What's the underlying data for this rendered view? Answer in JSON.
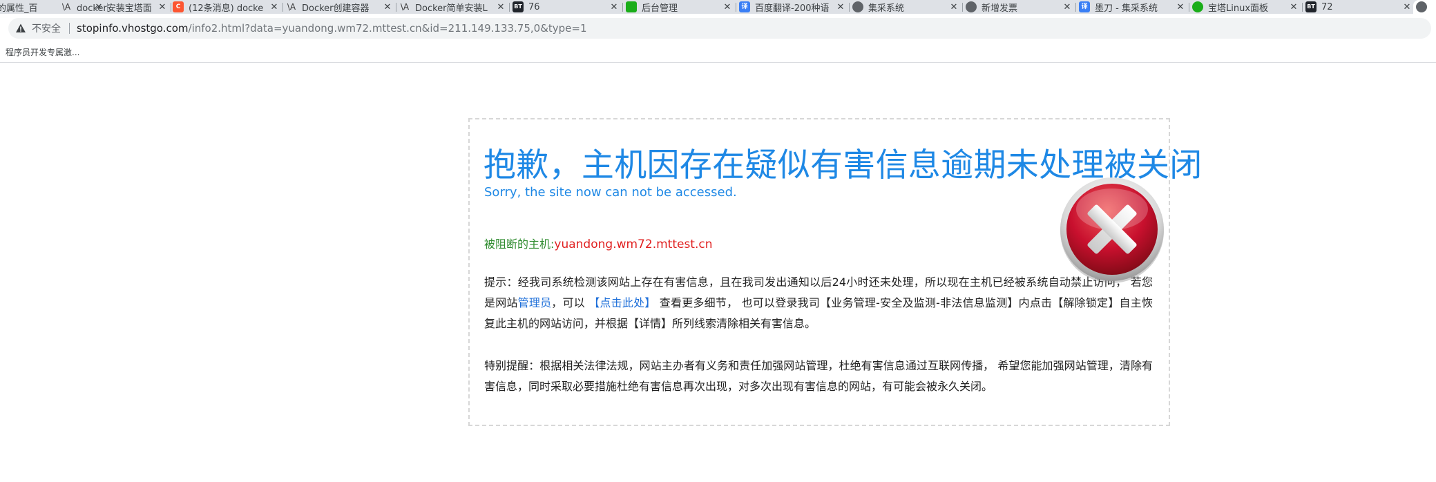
{
  "browser": {
    "tabs": [
      {
        "title": "的属性_百",
        "favicon": "none",
        "close": "✕"
      },
      {
        "title": "docker安装宝塔面",
        "favicon": "va",
        "close": "✕"
      },
      {
        "title": "(12条消息) docke",
        "favicon": "c",
        "close": "✕"
      },
      {
        "title": "Docker创建容器",
        "favicon": "va",
        "close": "✕"
      },
      {
        "title": "Docker简单安装L",
        "favicon": "va",
        "close": "✕"
      },
      {
        "title": "76",
        "favicon": "bt",
        "close": "✕"
      },
      {
        "title": "后台管理",
        "favicon": "green",
        "close": "✕"
      },
      {
        "title": "百度翻译-200种语",
        "favicon": "blue",
        "close": "✕"
      },
      {
        "title": "集采系统",
        "favicon": "globe",
        "close": "✕"
      },
      {
        "title": "新增发票",
        "favicon": "globe",
        "close": "✕"
      },
      {
        "title": "墨刀 - 集采系统",
        "favicon": "blue",
        "close": "✕"
      },
      {
        "title": "宝塔Linux面板",
        "favicon": "dot",
        "close": "✕"
      },
      {
        "title": "72",
        "favicon": "bt",
        "close": "✕"
      },
      {
        "title": "",
        "favicon": "globe",
        "close": ""
      }
    ],
    "favicon_text": {
      "bt": "BT",
      "c": "C",
      "va": "\\A",
      "blue": "译"
    },
    "security_label": "不安全",
    "url_host": "stopinfo.vhostgo.com",
    "url_rest": "/info2.html?data=yuandong.wm72.mttest.cn&id=211.149.133.75,0&type=1",
    "bookmark": "程序员开发专属激..."
  },
  "page": {
    "headline": "抱歉，主机因存在疑似有害信息逾期未处理被关闭",
    "subline": "Sorry, the site now can not be accessed.",
    "blocked_label": "被阻断的主机:",
    "blocked_host": "yuandong.wm72.mttest.cn",
    "p1_a": "提示：经我司系统检测该网站上存在有害信息，且在我司发出通知以后24小时还未处理，所以现在主机已经被系统自动禁止访问，  若您是网站",
    "p1_admin": "管理员",
    "p1_b": "，可以 ",
    "p1_click": "【点击此处】",
    "p1_c": " 查看更多细节，  也可以登录我司【业务管理-安全及监测-非法信息监测】内点击【解除锁定】自主恢复此主机的网站访问，并根据【详情】所列线索清除相关有害信息。",
    "p2": "特别提醒：根据相关法律法规，网站主办者有义务和责任加强网站管理，杜绝有害信息通过互联网传播，  希望您能加强网站管理，清除有害信息，同时采取必要措施杜绝有害信息再次出现，对多次出现有害信息的网站，有可能会被永久关闭。"
  },
  "colors": {
    "accent": "#1e88e5",
    "blocked_label": "#2e8b2e",
    "blocked_host": "#e02020",
    "error_red": "#c8102e"
  }
}
